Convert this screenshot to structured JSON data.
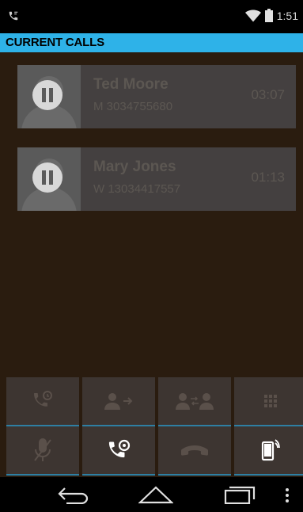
{
  "status_bar": {
    "time": "1:51",
    "icons": [
      "phone-in-call-icon",
      "wifi-icon",
      "battery-icon"
    ]
  },
  "header": {
    "title": "CURRENT CALLS"
  },
  "calls": [
    {
      "name": "Ted Moore",
      "number": "M 3034755680",
      "duration": "03:07",
      "state": "on-hold"
    },
    {
      "name": "Mary Jones",
      "number": "W 13034417557",
      "duration": "01:13",
      "state": "on-hold"
    }
  ],
  "controls": {
    "row1": [
      "add-call-icon",
      "transfer-icon",
      "merge-calls-icon",
      "dialpad-icon"
    ],
    "row2": [
      "mute-icon",
      "swap-calls-icon",
      "end-call-icon",
      "speaker-icon"
    ]
  },
  "colors": {
    "accent": "#2eb2e8",
    "background": "#2a1c0f",
    "card": "#444040"
  },
  "nav": [
    "back-icon",
    "home-icon",
    "recents-icon",
    "menu-icon"
  ]
}
